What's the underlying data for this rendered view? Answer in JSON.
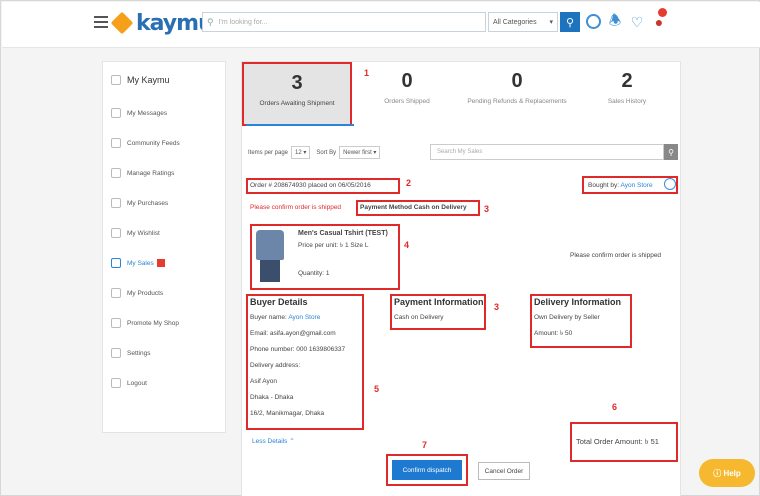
{
  "header": {
    "logo_text": "kaymu",
    "search_placeholder": "I'm looking for...",
    "category_label": "All Categories"
  },
  "sidebar": {
    "items": [
      {
        "label": "My Kaymu"
      },
      {
        "label": "My Messages"
      },
      {
        "label": "Community Feeds"
      },
      {
        "label": "Manage Ratings"
      },
      {
        "label": "My Purchases"
      },
      {
        "label": "My Wishlist"
      },
      {
        "label": "My Sales"
      },
      {
        "label": "My Products"
      },
      {
        "label": "Promote My Shop"
      },
      {
        "label": "Settings"
      },
      {
        "label": "Logout"
      }
    ]
  },
  "tabs": [
    {
      "count": "3",
      "label": "Orders Awaiting Shipment"
    },
    {
      "count": "0",
      "label": "Orders Shipped"
    },
    {
      "count": "0",
      "label": "Pending Refunds & Replacements"
    },
    {
      "count": "2",
      "label": "Sales History"
    }
  ],
  "annotations": [
    "1",
    "2",
    "3",
    "3",
    "4",
    "5",
    "6",
    "7"
  ],
  "filters": {
    "items_per_page_label": "Items per page",
    "items_per_page_value": "12",
    "sort_label": "Sort By",
    "sort_value": "Newer first",
    "search_placeholder": "Search My Sales"
  },
  "order": {
    "order_text": "Order # 208674930 placed on 06/05/2016",
    "bought_by_label": "Bought by:",
    "bought_by_name": "Ayon Store",
    "confirm_warning": "Please confirm order is shipped",
    "payment_method": "Payment Method Cash on Delivery",
    "product_name": "Men's Casual Tshirt (TEST)",
    "price_line": "Price per unit: ৳ 1 Size L",
    "quantity": "Quantity: 1",
    "right_warning": "Please confirm order is shipped"
  },
  "buyer": {
    "title": "Buyer Details",
    "name_label": "Buyer name:",
    "name_value": "Ayon Store",
    "email": "Email: asifa.ayon@gmail.com",
    "phone": "Phone number: 000 1639806337",
    "address_label": "Delivery address:",
    "address_1": "Asif Ayon",
    "address_2": "Dhaka - Dhaka",
    "address_3": "16/2, Manikmagar, Dhaka"
  },
  "payment": {
    "title": "Payment Information",
    "value": "Cash on Delivery"
  },
  "delivery": {
    "title": "Delivery Information",
    "line_1": "Own Delivery by Seller",
    "line_2": "Amount: ৳ 50"
  },
  "footer": {
    "less_details": "Less Details",
    "total_label": "Total Order Amount: ৳ 51",
    "confirm_button": "Confirm dispatch",
    "cancel_button": "Cancel Order",
    "help_label": "Help"
  }
}
